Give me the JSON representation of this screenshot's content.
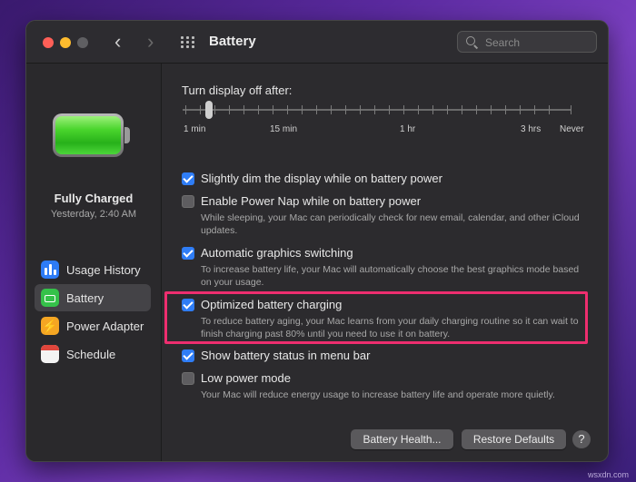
{
  "window": {
    "title": "Battery",
    "nav_back": "‹",
    "nav_forward": "›",
    "search": {
      "placeholder": "Search",
      "value": ""
    }
  },
  "sidebar": {
    "status_title": "Fully Charged",
    "status_time": "Yesterday, 2:40 AM",
    "items": [
      {
        "label": "Usage History",
        "icon": "usage-history-icon",
        "selected": false
      },
      {
        "label": "Battery",
        "icon": "battery-icon",
        "selected": true
      },
      {
        "label": "Power Adapter",
        "icon": "power-adapter-icon",
        "selected": false
      },
      {
        "label": "Schedule",
        "icon": "schedule-icon",
        "selected": false
      }
    ]
  },
  "display_off": {
    "title": "Turn display off after:",
    "value": "2 min",
    "tick_labels": [
      "1 min",
      "15 min",
      "1 hr",
      "3 hrs",
      "Never"
    ]
  },
  "options": [
    {
      "label": "Slightly dim the display while on battery power",
      "checked": true,
      "description": ""
    },
    {
      "label": "Enable Power Nap while on battery power",
      "checked": false,
      "description": "While sleeping, your Mac can periodically check for new email, calendar, and other iCloud updates."
    },
    {
      "label": "Automatic graphics switching",
      "checked": true,
      "description": "To increase battery life, your Mac will automatically choose the best graphics mode based on your usage."
    },
    {
      "label": "Optimized battery charging",
      "checked": true,
      "description": "To reduce battery aging, your Mac learns from your daily charging routine so it can wait to finish charging past 80% until you need to use it on battery."
    },
    {
      "label": "Show battery status in menu bar",
      "checked": true,
      "description": ""
    },
    {
      "label": "Low power mode",
      "checked": false,
      "description": "Your Mac will reduce energy usage to increase battery life and operate more quietly."
    }
  ],
  "buttons": {
    "battery_health": "Battery Health...",
    "restore_defaults": "Restore Defaults",
    "help": "?"
  },
  "colors": {
    "accent": "#2f7df6",
    "highlight_box": "#ee2e6f",
    "battery_green": "#4ad52d"
  },
  "watermark": "wsxdn.com"
}
